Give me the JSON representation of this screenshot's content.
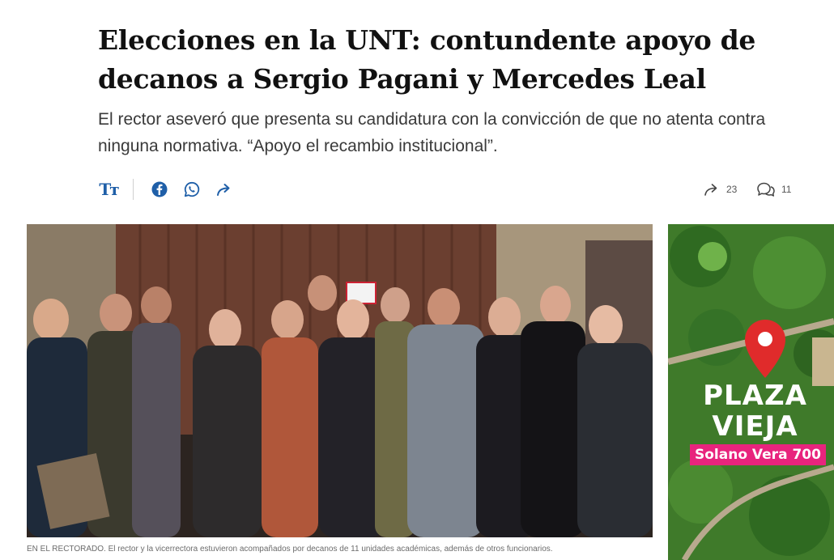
{
  "article": {
    "headline": "Elecciones en la UNT: contundente apoyo de decanos a Sergio Pagani y Mercedes Leal",
    "subtitle": "El rector aseveró que presenta su candidatura con la convicción de que no atenta contra ninguna normativa. “Apoyo el recambio institucional”."
  },
  "toolbar": {
    "text_size_label": "Tт",
    "share_count": "23",
    "comment_count": "11",
    "icons": [
      "text-size-icon",
      "facebook-icon",
      "whatsapp-icon",
      "share-icon",
      "share-count-icon",
      "comments-icon"
    ]
  },
  "photo": {
    "alt": "Group photo of deans with the rector and vice-rector in front of a brown wooden door",
    "caption": "EN EL RECTORADO. El rector y la vicerrectora estuvieron acompañados por decanos de 11 unidades académicas, además de otros funcionarios."
  },
  "ad": {
    "title_line1": "PLAZA",
    "title_line2": "VIEJA",
    "address": "Solano Vera 700",
    "colors": {
      "pin": "#e02b2b",
      "badge": "#e8247d",
      "greenery": "#3f7a2a"
    }
  },
  "colors": {
    "accent": "#1f5fa8",
    "headline": "#111111",
    "subtitle": "#3a3a3a",
    "caption": "#6b6b6b"
  }
}
